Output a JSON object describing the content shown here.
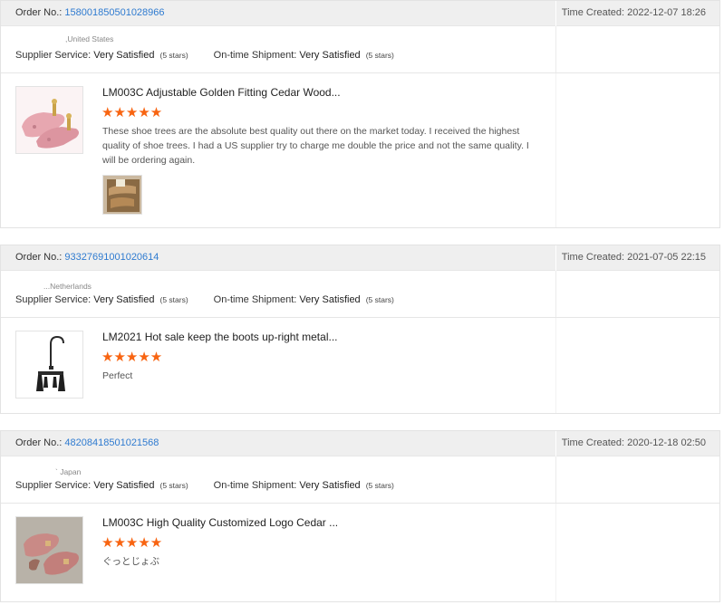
{
  "labels": {
    "order_no": "Order No.: ",
    "time_created": "Time Created: ",
    "supplier_service": "Supplier Service: ",
    "ontime_shipment": "On-time Shipment: "
  },
  "feedbacks": [
    {
      "order_no": "158001850501028966",
      "time_created": "2022-12-07 18:26",
      "country": ",United States",
      "supplier_rating": "Very Satisfied",
      "supplier_stars": "(5 stars)",
      "shipment_rating": "Very Satisfied",
      "shipment_stars": "(5 stars)",
      "product_title": "LM003C Adjustable Golden Fitting Cedar Wood...",
      "stars": "★★★★★",
      "review": "These shoe trees are the absolute best quality out there on the market today. I received the highest quality of shoe trees. I had a US supplier try to charge me double the price and not the same quality. I will be ordering again.",
      "has_photo": true
    },
    {
      "order_no": "93327691001020614",
      "time_created": "2021-07-05 22:15",
      "country": "...Netherlands",
      "supplier_rating": "Very Satisfied",
      "supplier_stars": "(5 stars)",
      "shipment_rating": "Very Satisfied",
      "shipment_stars": "(5 stars)",
      "product_title": "LM2021 Hot sale keep the boots up-right metal...",
      "stars": "★★★★★",
      "review": "Perfect",
      "has_photo": false
    },
    {
      "order_no": "48208418501021568",
      "time_created": "2020-12-18 02:50",
      "country": "` Japan",
      "supplier_rating": "Very Satisfied",
      "supplier_stars": "(5 stars)",
      "shipment_rating": "Very Satisfied",
      "shipment_stars": "(5 stars)",
      "product_title": "LM003C High Quality Customized Logo Cedar ...",
      "stars": "★★★★★",
      "review": "ぐっとじょぶ",
      "has_photo": false
    }
  ],
  "colors": {
    "accent_link": "#2f7bd0",
    "star": "#f86411",
    "header_bg": "#efefef"
  }
}
